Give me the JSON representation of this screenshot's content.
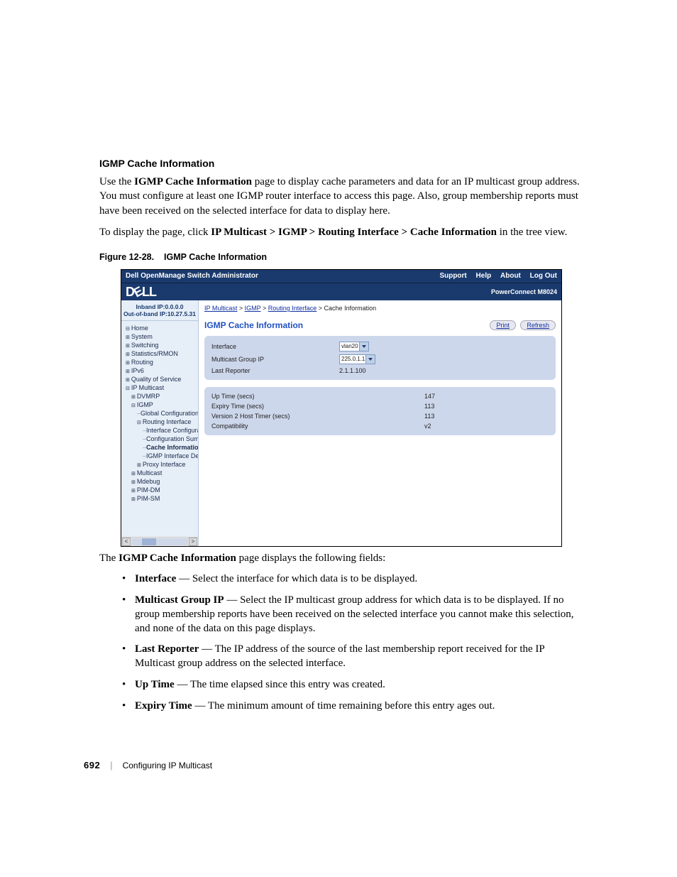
{
  "doc": {
    "section_heading": "IGMP Cache Information",
    "intro_p1_pre": "Use the ",
    "intro_p1_bold": "IGMP Cache Information",
    "intro_p1_post": " page to display cache parameters and data for an IP multicast group address. You must configure at least one IGMP router interface to access this page. Also, group membership reports must have been received on the selected interface for data to display here.",
    "intro_p2_pre": "To display the page, click ",
    "intro_p2_bold": "IP Multicast > IGMP > Routing Interface > Cache Information",
    "intro_p2_post": " in the tree view.",
    "fig_caption_num": "Figure 12-28.",
    "fig_caption_title": "IGMP Cache Information",
    "after_pre": "The ",
    "after_bold": "IGMP Cache Information",
    "after_post": " page displays the following fields:",
    "fields": [
      {
        "term": "Interface",
        "desc": " — Select the interface for which data is to be displayed."
      },
      {
        "term": "Multicast Group IP",
        "desc": " — Select the IP multicast group address for which data is to be displayed. If no group membership reports have been received on the selected interface you cannot make this selection, and none of the data on this page displays."
      },
      {
        "term": "Last Reporter",
        "desc": " — The IP address of the source of the last membership report received for the IP Multicast group address on the selected interface."
      },
      {
        "term": "Up Time",
        "desc": " — The time elapsed since this entry was created."
      },
      {
        "term": "Expiry Time",
        "desc": " — The minimum amount of time remaining before this entry ages out."
      }
    ],
    "page_number": "692",
    "chapter": "Configuring IP Multicast"
  },
  "shot": {
    "titlebar": "Dell OpenManage Switch Administrator",
    "top_links": [
      "Support",
      "Help",
      "About",
      "Log Out"
    ],
    "product": "PowerConnect M8024",
    "logo": "DELL",
    "nav_ip_line1": "Inband IP:0.0.0.0",
    "nav_ip_line2": "Out-of-band IP:10.27.5.31",
    "nav": [
      {
        "lv": 1,
        "k": "col",
        "t": "Home"
      },
      {
        "lv": 1,
        "k": "exp",
        "t": "System"
      },
      {
        "lv": 1,
        "k": "exp",
        "t": "Switching"
      },
      {
        "lv": 1,
        "k": "exp",
        "t": "Statistics/RMON"
      },
      {
        "lv": 1,
        "k": "exp",
        "t": "Routing"
      },
      {
        "lv": 1,
        "k": "exp",
        "t": "IPv6"
      },
      {
        "lv": 1,
        "k": "exp",
        "t": "Quality of Service"
      },
      {
        "lv": 1,
        "k": "col",
        "t": "IP Multicast"
      },
      {
        "lv": 2,
        "k": "exp",
        "t": "DVMRP"
      },
      {
        "lv": 2,
        "k": "col",
        "t": "IGMP"
      },
      {
        "lv": 3,
        "k": "leaf",
        "t": "Global Configuration"
      },
      {
        "lv": 3,
        "k": "col",
        "t": "Routing Interface"
      },
      {
        "lv": 4,
        "k": "leaf",
        "t": "Interface Configura"
      },
      {
        "lv": 4,
        "k": "leaf",
        "t": "Configuration Sum"
      },
      {
        "lv": 4,
        "k": "leaf",
        "t": "Cache Informatio",
        "cur": true
      },
      {
        "lv": 4,
        "k": "leaf",
        "t": "IGMP Interface De"
      },
      {
        "lv": 3,
        "k": "exp",
        "t": "Proxy Interface"
      },
      {
        "lv": 2,
        "k": "exp",
        "t": "Multicast"
      },
      {
        "lv": 2,
        "k": "exp",
        "t": "Mdebug"
      },
      {
        "lv": 2,
        "k": "exp",
        "t": "PIM-DM"
      },
      {
        "lv": 2,
        "k": "exp",
        "t": "PIM-SM"
      }
    ],
    "breadcrumb": [
      {
        "t": "IP Multicast",
        "link": true
      },
      {
        "t": "IGMP",
        "link": true
      },
      {
        "t": "Routing Interface",
        "link": true
      },
      {
        "t": "Cache Information",
        "link": false
      }
    ],
    "page_title": "IGMP Cache Information",
    "buttons": {
      "print": "Print",
      "refresh": "Refresh"
    },
    "panel1": {
      "rows": [
        {
          "label": "Interface",
          "select": "vlan20"
        },
        {
          "label": "Multicast Group IP",
          "select": "225.0.1.1"
        },
        {
          "label": "Last Reporter",
          "text": "2.1.1.100"
        }
      ]
    },
    "panel2": {
      "rows": [
        {
          "label": "Up Time (secs)",
          "val": "147"
        },
        {
          "label": "Expiry Time (secs)",
          "val": "113"
        },
        {
          "label": "Version 2 Host Timer (secs)",
          "val": "113"
        },
        {
          "label": "Compatibility",
          "val": "v2"
        }
      ]
    },
    "scroll_glyphs": {
      "left": "<",
      "right": ">"
    }
  }
}
